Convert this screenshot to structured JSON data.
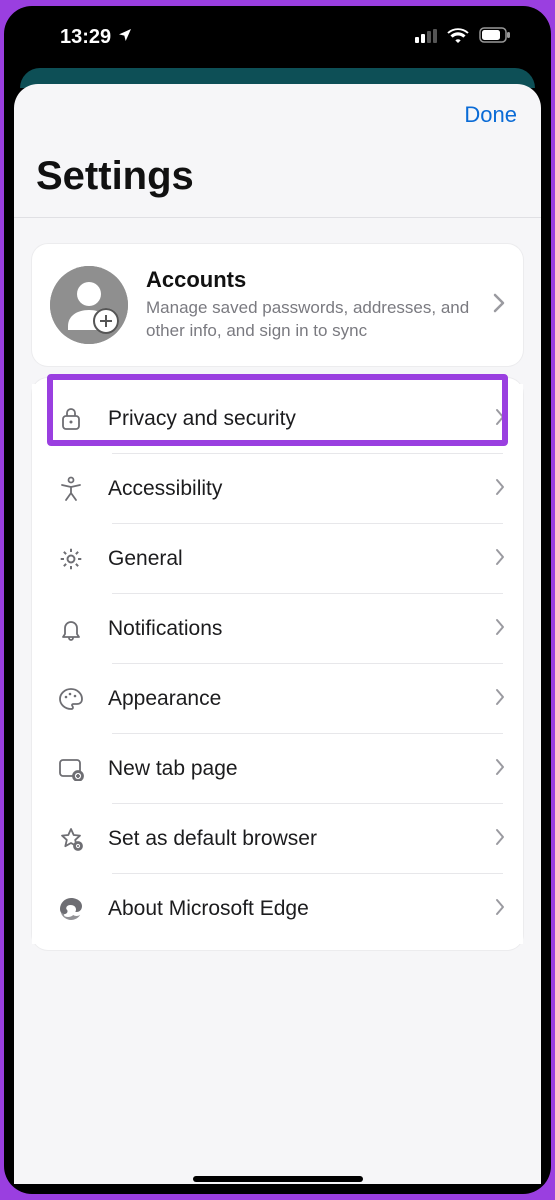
{
  "status": {
    "time": "13:29"
  },
  "header": {
    "done": "Done",
    "title": "Settings"
  },
  "accounts": {
    "title": "Accounts",
    "subtitle": "Manage saved passwords, addresses, and other info, and sign in to sync"
  },
  "rows": [
    {
      "icon": "lock-icon",
      "label": "Privacy and security",
      "highlighted": true
    },
    {
      "icon": "accessibility-icon",
      "label": "Accessibility",
      "highlighted": false
    },
    {
      "icon": "gear-icon",
      "label": "General",
      "highlighted": false
    },
    {
      "icon": "bell-icon",
      "label": "Notifications",
      "highlighted": false
    },
    {
      "icon": "palette-icon",
      "label": "Appearance",
      "highlighted": false
    },
    {
      "icon": "newtab-icon",
      "label": "New tab page",
      "highlighted": false
    },
    {
      "icon": "star-gear-icon",
      "label": "Set as default browser",
      "highlighted": false
    },
    {
      "icon": "edge-icon",
      "label": "About Microsoft Edge",
      "highlighted": false
    }
  ]
}
